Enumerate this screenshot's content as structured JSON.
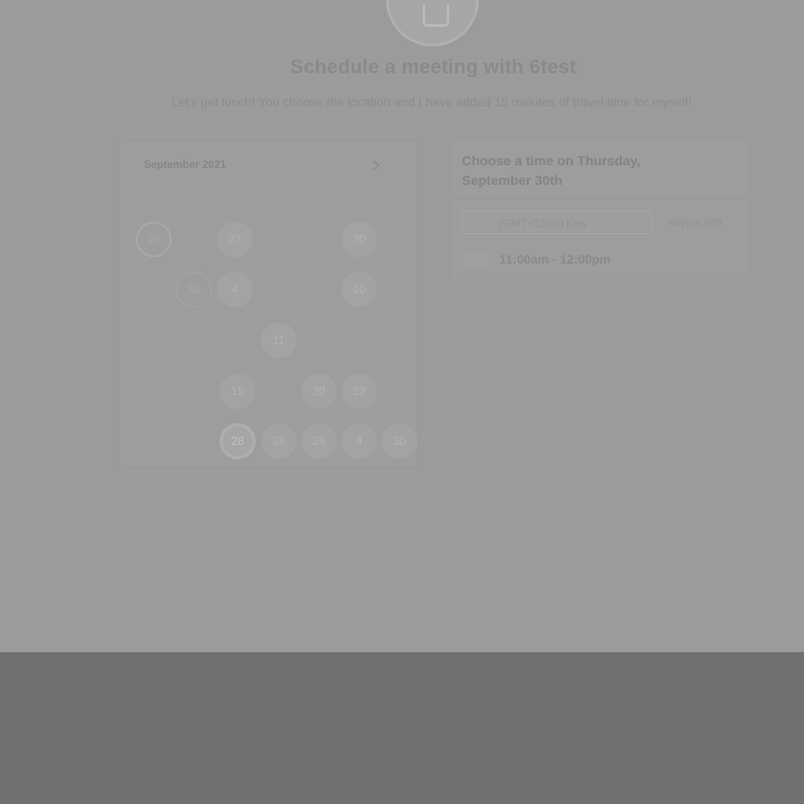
{
  "header": {
    "title": "Schedule a meeting with 6test",
    "description": "Let's get lunch! You choose the location and I have added 15 minutes of travel time for myself!"
  },
  "calendar": {
    "month_label": "September 2021",
    "weekday_labels": [
      "",
      "",
      "",
      "",
      "",
      "",
      ""
    ],
    "days": [
      {
        "label": "26",
        "state": "ring"
      },
      {
        "label": "27",
        "state": "available"
      },
      {
        "label": "30",
        "state": "available"
      },
      {
        "label": "30",
        "state": "ringdash"
      },
      {
        "label": "4",
        "state": "available"
      },
      {
        "label": "10",
        "state": "available"
      },
      {
        "label": "11",
        "state": "available"
      },
      {
        "label": "15",
        "state": "available"
      },
      {
        "label": "20",
        "state": "available"
      },
      {
        "label": "23",
        "state": "available"
      },
      {
        "label": "28",
        "state": "selected"
      },
      {
        "label": "28",
        "state": "available"
      },
      {
        "label": "29",
        "state": "available"
      },
      {
        "label": "4",
        "state": "available"
      },
      {
        "label": "30",
        "state": "available"
      }
    ]
  },
  "time_panel": {
    "title_line1": "Choose a time on Thursday,",
    "title_line2": "September 30th",
    "timezone_value": "(GMT+03:00) Kiev",
    "format_toggle": "am/pm  24h",
    "slots": [
      "11:00am - 12:00pm"
    ]
  },
  "icons": {
    "next_month": "chevron-right-icon",
    "dropdown": "caret-down-icon"
  }
}
